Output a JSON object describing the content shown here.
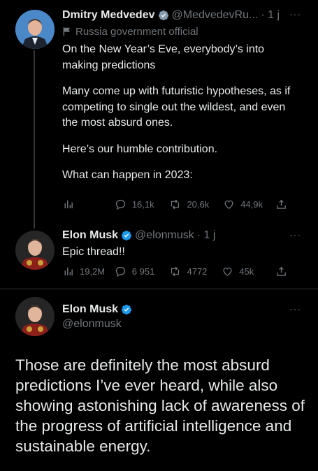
{
  "tweet1": {
    "name": "Dmitry Medvedev",
    "handle": "@MedvedevRu...",
    "time": "· 1 j",
    "label": "Russia government official",
    "paragraphs": [
      "On the New Year’s Eve, everybody’s into making predictions",
      "Many come up with futuristic hypotheses, as if competing to single out the wildest, and even the most absurd ones.",
      "Here’s our humble contribution.",
      "What can happen in 2023:"
    ],
    "replies": "16,1k",
    "retweets": "20,6k",
    "likes": "44,9k"
  },
  "tweet2": {
    "name": "Elon Musk",
    "handle": "@elonmusk",
    "time": "· 1 j",
    "text": "Epic thread!!",
    "views": "19,2M",
    "replies": "6 951",
    "retweets": "4772",
    "likes": "45k"
  },
  "tweet3": {
    "name": "Elon Musk",
    "handle": "@elonmusk",
    "text": "Those are definitely the most absurd predictions I’ve ever heard, while also showing astonishing lack of awareness of the progress of artificial intelligence and sustainable energy."
  },
  "more_glyph": "···",
  "colors": {
    "verified": "#1d9bf0",
    "muted": "#71767b",
    "background": "#000000"
  }
}
